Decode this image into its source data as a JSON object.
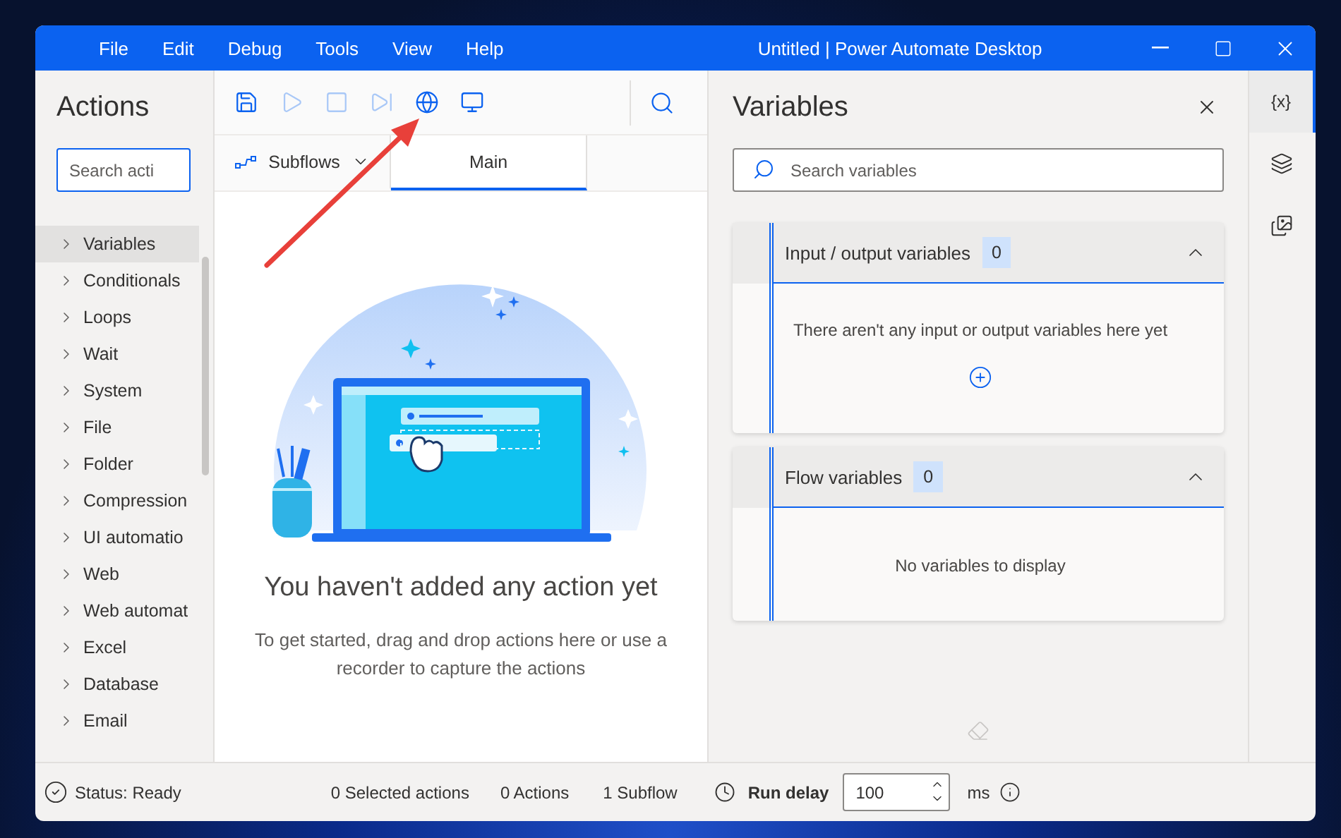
{
  "window": {
    "title": "Untitled | Power Automate Desktop"
  },
  "menu": [
    "File",
    "Edit",
    "Debug",
    "Tools",
    "View",
    "Help"
  ],
  "actions_panel": {
    "title": "Actions",
    "search": {
      "placeholder": "Search acti"
    },
    "items": [
      {
        "label": "Variables",
        "selected": true
      },
      {
        "label": "Conditionals",
        "selected": false
      },
      {
        "label": "Loops",
        "selected": false
      },
      {
        "label": "Wait",
        "selected": false
      },
      {
        "label": "System",
        "selected": false
      },
      {
        "label": "File",
        "selected": false
      },
      {
        "label": "Folder",
        "selected": false
      },
      {
        "label": "Compression",
        "selected": false
      },
      {
        "label": "UI automatio",
        "selected": false
      },
      {
        "label": "Web",
        "selected": false
      },
      {
        "label": "Web automat",
        "selected": false
      },
      {
        "label": "Excel",
        "selected": false
      },
      {
        "label": "Database",
        "selected": false
      },
      {
        "label": "Email",
        "selected": false
      }
    ]
  },
  "toolbar": [
    {
      "kind": "save",
      "disabled": false
    },
    {
      "kind": "run",
      "disabled": true
    },
    {
      "kind": "stop",
      "disabled": true
    },
    {
      "kind": "step",
      "disabled": true
    },
    {
      "kind": "web-recorder",
      "disabled": false
    },
    {
      "kind": "desktop-recorder",
      "disabled": false
    }
  ],
  "tabs": [
    {
      "label": "Subflows",
      "kind": "dropdown",
      "selected": false
    },
    {
      "label": "Main",
      "kind": "tab",
      "selected": true
    }
  ],
  "empty_state": {
    "heading": "You haven't added any action yet",
    "text": "To get started, drag and drop actions here or use a recorder to capture the actions"
  },
  "variables_panel": {
    "title": "Variables",
    "search": {
      "placeholder": "Search variables"
    },
    "sections": [
      {
        "title": "Input / output variables",
        "count": "0",
        "expanded": true,
        "empty_text": "There aren't any input or output variables here yet",
        "has_add": true
      },
      {
        "title": "Flow variables",
        "count": "0",
        "expanded": true,
        "empty_text": "No variables to display",
        "has_add": false
      }
    ]
  },
  "side_rail": [
    {
      "kind": "variables",
      "label": "{x}",
      "selected": true
    },
    {
      "kind": "layers",
      "selected": false
    },
    {
      "kind": "images",
      "selected": false
    }
  ],
  "status_bar": {
    "status": "Status: Ready",
    "selected_actions": "0 Selected actions",
    "actions": "0 Actions",
    "subflows": "1 Subflow",
    "run_delay_label": "Run delay",
    "run_delay_value": "100",
    "unit": "ms"
  }
}
